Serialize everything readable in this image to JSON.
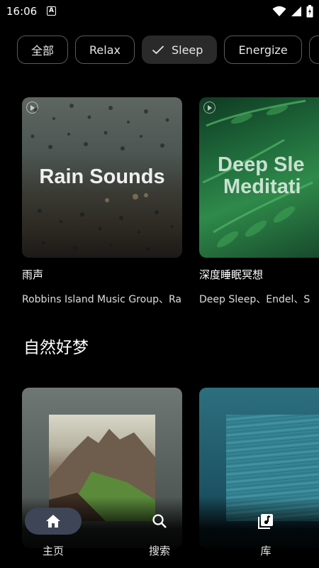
{
  "status_bar": {
    "time": "16:06",
    "notification_letter": "A"
  },
  "chips": [
    {
      "label": "全部",
      "selected": false
    },
    {
      "label": "Relax",
      "selected": false
    },
    {
      "label": "Sleep",
      "selected": true
    },
    {
      "label": "Energize",
      "selected": false
    }
  ],
  "row1": [
    {
      "art_text": "Rain Sounds",
      "title": "雨声",
      "subtitle": "Robbins Island Music Group、Ra"
    },
    {
      "art_text_line1": "Deep Sle",
      "art_text_line2": "Meditati",
      "title": "深度睡眠冥想",
      "subtitle": "Deep Sleep、Endel、S"
    }
  ],
  "section": {
    "title": "自然好梦"
  },
  "nav": [
    {
      "label": "主页",
      "icon": "home-icon",
      "active": true
    },
    {
      "label": "搜索",
      "icon": "search-icon",
      "active": false
    },
    {
      "label": "库",
      "icon": "library-icon",
      "active": false
    }
  ],
  "colors": {
    "background": "#000000",
    "chip_selected": "#2a2a2a",
    "nav_active_pill": "#3e4557"
  }
}
